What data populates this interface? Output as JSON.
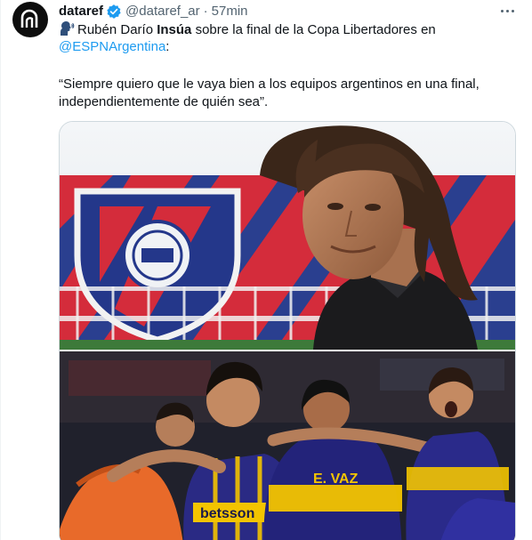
{
  "tweet": {
    "author_name": "dataref",
    "handle": "@dataref_ar",
    "separator": "·",
    "time": "57min",
    "verified": true,
    "avatar_icon": "dataref-logo-icon",
    "more_icon": "more-dots-icon",
    "text": {
      "emoji": "speaking-head-icon",
      "line1_pre": "Rubén Darío ",
      "line1_bold": "Insúa",
      "line1_post": " sobre la final de la Copa Libertadores en",
      "mention": "@ESPNArgentina",
      "mention_suffix": ":",
      "quote_line1": "“Siempre quiero que le vaya bien a los equipos argentinos en una final,",
      "quote_line2": "independientemente de quién sea”."
    },
    "media": {
      "top_image": "coach-portrait-stadium-photo",
      "bottom_image": "players-celebration-photo",
      "shirt_sponsor": "betsson",
      "shirt_name": "E. VAZ"
    }
  },
  "colors": {
    "link": "#1d9bf0",
    "verified": "#1d9bf0",
    "secondary_text": "#536471",
    "border": "#cfd9de"
  }
}
